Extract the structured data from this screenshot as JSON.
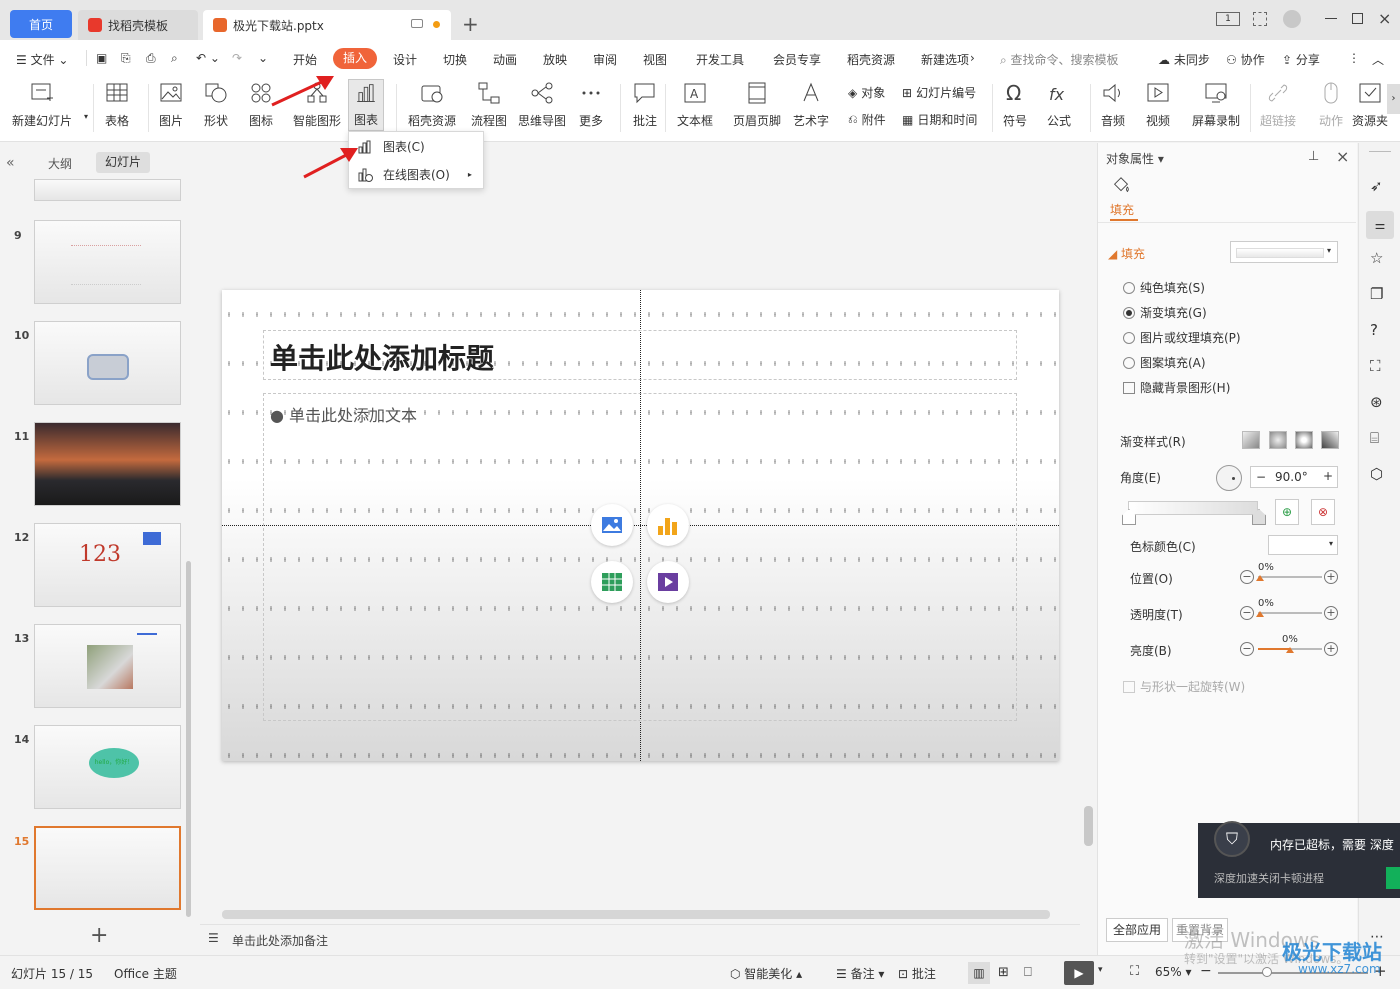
{
  "tabs": {
    "home": "首页",
    "template": "找稻壳模板",
    "file": "极光下载站.pptx"
  },
  "menu": {
    "file": "文件",
    "items": [
      "开始",
      "插入",
      "设计",
      "切换",
      "动画",
      "放映",
      "审阅",
      "视图",
      "开发工具",
      "会员专享",
      "稻壳资源",
      "新建选项"
    ],
    "search": "查找命令、搜索模板",
    "sync": "未同步",
    "collab": "协作",
    "share": "分享"
  },
  "ribbon": {
    "new_slide": "新建幻灯片",
    "table": "表格",
    "picture": "图片",
    "shape": "形状",
    "icon": "图标",
    "smart": "智能图形",
    "chart": "图表",
    "docer": "稻壳资源",
    "flow": "流程图",
    "mind": "思维导图",
    "more": "更多",
    "comment": "批注",
    "textbox": "文本框",
    "header": "页眉页脚",
    "art": "艺术字",
    "object": "对象",
    "slide_no": "幻灯片编号",
    "attach": "附件",
    "datetime": "日期和时间",
    "symbol": "符号",
    "formula": "公式",
    "audio": "音频",
    "video": "视频",
    "screenrec": "屏幕录制",
    "link": "超链接",
    "action": "动作",
    "resource": "资源夹"
  },
  "dropdown": {
    "chart": "图表(C)",
    "online": "在线图表(O)"
  },
  "left": {
    "outline": "大纲",
    "slides": "幻灯片",
    "nums": [
      "9",
      "10",
      "11",
      "12",
      "13",
      "14",
      "15"
    ],
    "slide12_text": "123",
    "slide14_text": "hello，你好！"
  },
  "slide": {
    "title": "单击此处添加标题",
    "body": "单击此处添加文本"
  },
  "notes": "单击此处添加备注",
  "panel": {
    "title": "对象属性",
    "tab_fill": "填充",
    "section_fill": "填充",
    "opt_solid": "纯色填充(S)",
    "opt_gradient": "渐变填充(G)",
    "opt_picture": "图片或纹理填充(P)",
    "opt_pattern": "图案填充(A)",
    "opt_hide": "隐藏背景图形(H)",
    "grad_style": "渐变样式(R)",
    "angle": "角度(E)",
    "angle_val": "90.0°",
    "stop_color": "色标颜色(C)",
    "position": "位置(O)",
    "transparency": "透明度(T)",
    "brightness": "亮度(B)",
    "pct": "0%",
    "rotate": "与形状一起旋转(W)",
    "apply_all": "全部应用",
    "reset_bg": "重置背景"
  },
  "toast": {
    "title": "内存已超标，需要 深度",
    "sub": "深度加速关闭卡顿进程"
  },
  "status": {
    "slide_info": "幻灯片 15 / 15",
    "theme": "Office 主题",
    "beautify": "智能美化",
    "notes": "备注",
    "comment": "批注",
    "zoom": "65%"
  },
  "watermark": {
    "activate": "激活 Windows",
    "goto": "转到\"设置\"以激活 Windows。",
    "site": "极光下载站",
    "url": "www.xz7.com"
  },
  "colors": {
    "accent": "#3f7cf0",
    "insert_tab": "#f0643a",
    "selected_border": "#e0782e",
    "arrow": "#e02020"
  }
}
